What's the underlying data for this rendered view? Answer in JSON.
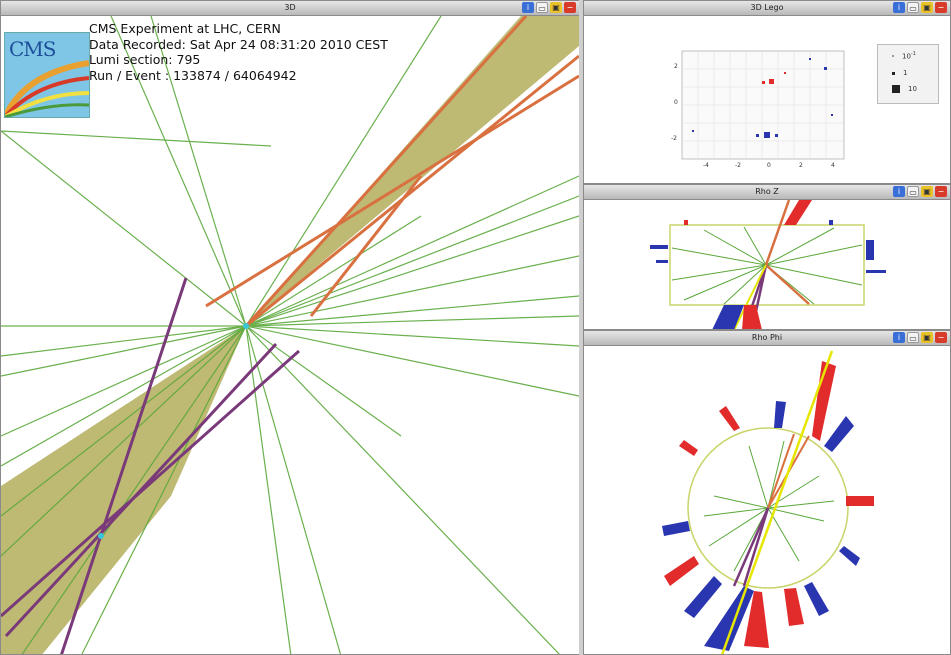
{
  "views": {
    "main": {
      "title": "3D"
    },
    "lego": {
      "title": "3D Lego"
    },
    "rhoz": {
      "title": "Rho Z"
    },
    "rhophi": {
      "title": "Rho Phi"
    }
  },
  "buttons": {
    "info": "i",
    "undock": "",
    "maximize": "",
    "close": "−"
  },
  "event_info": {
    "line1": "CMS Experiment at LHC, CERN",
    "line2": "Data Recorded: Sat Apr 24 08:31:20 2010 CEST",
    "line3": "Lumi section: 795",
    "line4": "Run / Event : 133874 / 64064942"
  },
  "logo": {
    "text": "CMS"
  },
  "lego": {
    "y_ticks": [
      "2",
      "0",
      "-2"
    ],
    "x_ticks": [
      "-4",
      "-2",
      "0",
      "2",
      "4"
    ],
    "legend": [
      "10",
      "1",
      "10"
    ],
    "legend_exp": "-1"
  },
  "colors": {
    "track": "#5aa83a",
    "jet_cone": "#b3ad5a",
    "electron": "#d97040",
    "muon": "#7a3a7a",
    "ecal": "#e22b2b",
    "hcal": "#2a35b0",
    "met": "#e6e600"
  }
}
